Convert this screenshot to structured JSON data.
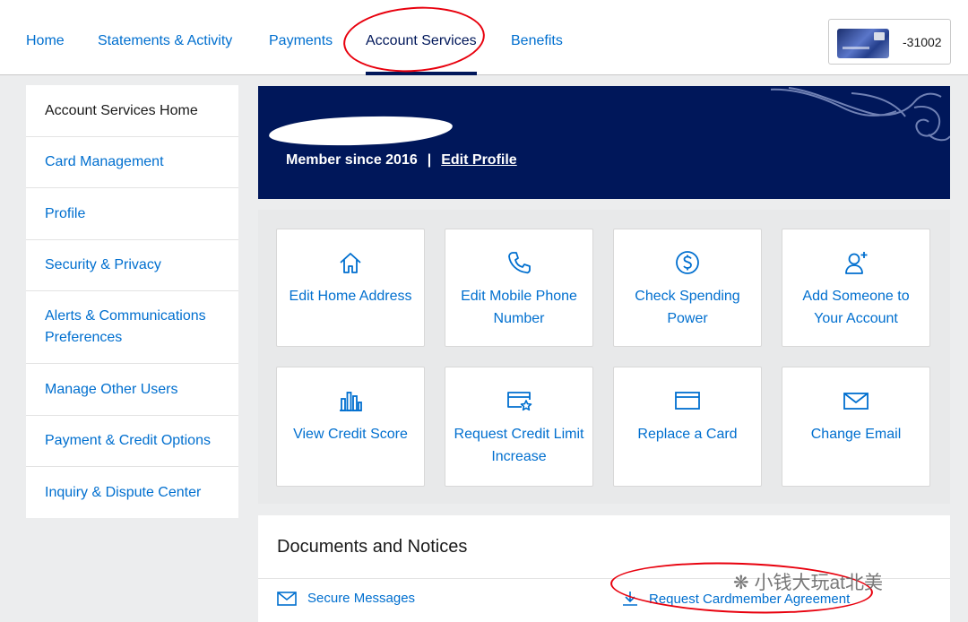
{
  "nav": {
    "items": [
      "Home",
      "Statements & Activity",
      "Payments",
      "Account Services",
      "Benefits"
    ],
    "active": "Account Services",
    "card_number": "-31002"
  },
  "sidebar": {
    "items": [
      {
        "label": "Account Services Home",
        "current": true
      },
      {
        "label": "Card Management"
      },
      {
        "label": "Profile"
      },
      {
        "label": "Security & Privacy"
      },
      {
        "label": "Alerts & Communications Preferences"
      },
      {
        "label": "Manage Other Users"
      },
      {
        "label": "Payment & Credit Options"
      },
      {
        "label": "Inquiry & Dispute Center"
      }
    ]
  },
  "banner": {
    "member_since": "Member since 2016",
    "separator": "|",
    "edit_profile": "Edit Profile"
  },
  "tiles": [
    {
      "label": "Edit Home Address",
      "icon": "home-icon"
    },
    {
      "label": "Edit Mobile Phone Number",
      "icon": "phone-icon"
    },
    {
      "label": "Check Spending Power",
      "icon": "dollar-circle-icon"
    },
    {
      "label": "Add Someone to Your Account",
      "icon": "add-user-icon"
    },
    {
      "label": "View Credit Score",
      "icon": "bar-chart-icon"
    },
    {
      "label": "Request Credit Limit Increase",
      "icon": "card-star-icon"
    },
    {
      "label": "Replace a Card",
      "icon": "card-icon"
    },
    {
      "label": "Change Email",
      "icon": "envelope-icon"
    }
  ],
  "documents": {
    "title": "Documents and Notices",
    "secure_messages": "Secure Messages",
    "request_agreement": "Request Cardmember Agreement"
  },
  "watermark": "小钱大玩at北美",
  "colors": {
    "link_blue": "#006fcf",
    "navy": "#00175a",
    "annotation_red": "#e8000d"
  }
}
